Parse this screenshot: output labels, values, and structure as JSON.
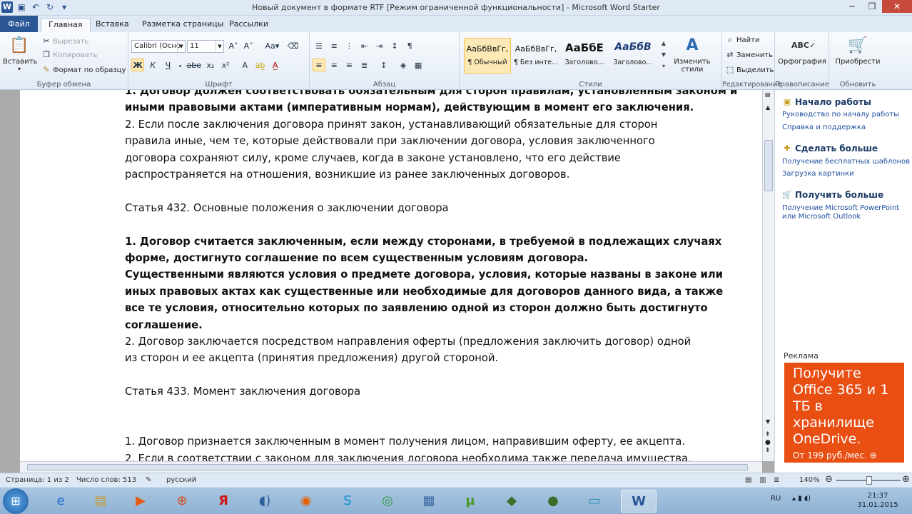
{
  "window": {
    "title": "Новый документ в формате RTF [Режим ограниченной функциональности] - Microsoft Word Starter"
  },
  "tabs": {
    "file": "Файл",
    "home": "Главная",
    "insert": "Вставка",
    "layout": "Разметка страницы",
    "mailings": "Рассылки"
  },
  "ribbon": {
    "clipboard": {
      "paste": "Вставить",
      "cut": "Вырезать",
      "copy": "Копировать",
      "format_painter": "Формат по образцу",
      "label": "Буфер обмена"
    },
    "font": {
      "name": "Calibri (Осно",
      "size": "11",
      "label": "Шрифт",
      "bold": "Ж",
      "italic": "К",
      "underline": "Ч",
      "strike": "abe",
      "sub": "x₂",
      "sup": "x²"
    },
    "paragraph": {
      "label": "Абзац"
    },
    "styles": {
      "label": "Стили",
      "items": [
        {
          "preview": "АаБбВвГг,",
          "name": "¶ Обычный"
        },
        {
          "preview": "АаБбВвГг,",
          "name": "¶ Без инте..."
        },
        {
          "preview": "АаБбЕ",
          "name": "Заголово..."
        },
        {
          "preview": "АаБбВ",
          "name": "Заголово..."
        }
      ],
      "change_styles": "Изменить стили"
    },
    "editing": {
      "find": "Найти",
      "replace": "Заменить",
      "select": "Выделить",
      "label": "Редактирование"
    },
    "proofing": {
      "spelling": "Орфография",
      "label": "Правописание"
    },
    "upgrade": {
      "button": "Приобрести",
      "label": "Обновить"
    }
  },
  "document": {
    "lines": [
      {
        "text": "1. Договор должен соответствовать обязательным для сторон правилам, установленным законом и",
        "bold": true
      },
      {
        "text": "иными правовыми актами (императивным нормам), действующим в момент его заключения.",
        "bold": true
      },
      {
        "text": "2. Если после заключения договора принят закон, устанавливающий обязательные для сторон",
        "bold": false
      },
      {
        "text": "правила иные, чем те, которые действовали при заключении договора, условия заключенного",
        "bold": false
      },
      {
        "text": "договора сохраняют силу, кроме случаев, когда в законе установлено, что его действие",
        "bold": false
      },
      {
        "text": "распространяется на отношения, возникшие из ранее заключенных договоров.",
        "bold": false
      },
      {
        "text": "",
        "bold": false
      },
      {
        "text": "Статья 432. Основные положения о заключении договора",
        "bold": false
      },
      {
        "text": "",
        "bold": false
      },
      {
        "text": "1. Договор считается заключенным, если между сторонами, в требуемой в подлежащих случаях",
        "bold": true
      },
      {
        "text": "форме, достигнуто соглашение по всем существенным условиям договора.",
        "bold": true
      },
      {
        "text": "Существенными являются условия о предмете договора, условия, которые названы в законе или",
        "bold": true
      },
      {
        "text": "иных правовых актах как существенные или необходимые для договоров данного вида, а также",
        "bold": true
      },
      {
        "text": "все те условия, относительно которых по заявлению одной из сторон должно быть достигнуто",
        "bold": true
      },
      {
        "text": "соглашение.",
        "bold": true
      },
      {
        "text": "2. Договор заключается посредством направления оферты (предложения заключить договор) одной",
        "bold": false
      },
      {
        "text": "из сторон и ее акцепта (принятия предложения) другой стороной.",
        "bold": false
      },
      {
        "text": "",
        "bold": false
      },
      {
        "text": "Статья 433. Момент заключения договора",
        "bold": false
      },
      {
        "text": "",
        "bold": false
      },
      {
        "text": "",
        "bold": false
      },
      {
        "text": "1. Договор признается заключенным в момент получения лицом, направившим оферту, ее акцепта.",
        "bold": false
      },
      {
        "text": "2. Если в соответствии с законом для заключения договора необходима также передача имущества,",
        "bold": false
      }
    ]
  },
  "sidepane": {
    "start_title": "Начало работы",
    "start_links": [
      "Руководство по началу работы",
      "Справка и поддержка"
    ],
    "more_title": "Сделать больше",
    "more_links": [
      "Получение бесплатных шаблонов",
      "Загрузка картинки"
    ],
    "get_title": "Получить больше",
    "get_links": [
      "Получение Microsoft PowerPoint или Microsoft Outlook"
    ],
    "ad_label": "Реклама",
    "ad_headline": "Получите Office 365 и 1 ТБ в хранилище OneDrive.",
    "ad_price": "От 199 руб./мес.",
    "ad_brand": "Office 365",
    "ad_color": "#e94e13"
  },
  "status": {
    "page": "Страница: 1 из 2",
    "words": "Число слов: 513",
    "lang": "русский",
    "zoom": "140%"
  },
  "taskbar": {
    "lang": "RU",
    "time": "21:37",
    "date": "31.01.2015"
  }
}
